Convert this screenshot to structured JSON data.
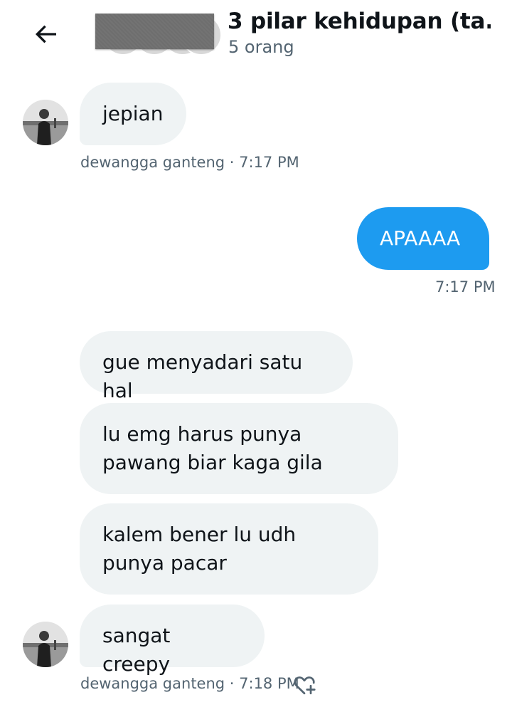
{
  "header": {
    "title": "3 pilar kehidupan (ta...",
    "subtitle": "5 orang"
  },
  "messages": [
    {
      "text": "jepian",
      "sender": "dewangga ganteng",
      "time": "7:17 PM",
      "meta": "dewangga ganteng · 7:17 PM"
    },
    {
      "text": "APAAAA",
      "time": "7:17 PM"
    },
    {
      "text": "gue menyadari satu hal"
    },
    {
      "text": "lu emg harus punya pawang biar kaga gila"
    },
    {
      "text": "kalem bener lu udh punya pacar"
    },
    {
      "text": "sangat creepy",
      "sender": "dewangga ganteng",
      "time": "7:18 PM",
      "meta": "dewangga ganteng · 7:18 PM"
    }
  ],
  "colors": {
    "accent": "#1d9bf0",
    "incoming_bubble": "#eff3f4",
    "meta_text": "#536471",
    "text": "#0f1419"
  },
  "icons": {
    "back": "arrow-left-icon",
    "react": "heart-plus-icon"
  }
}
